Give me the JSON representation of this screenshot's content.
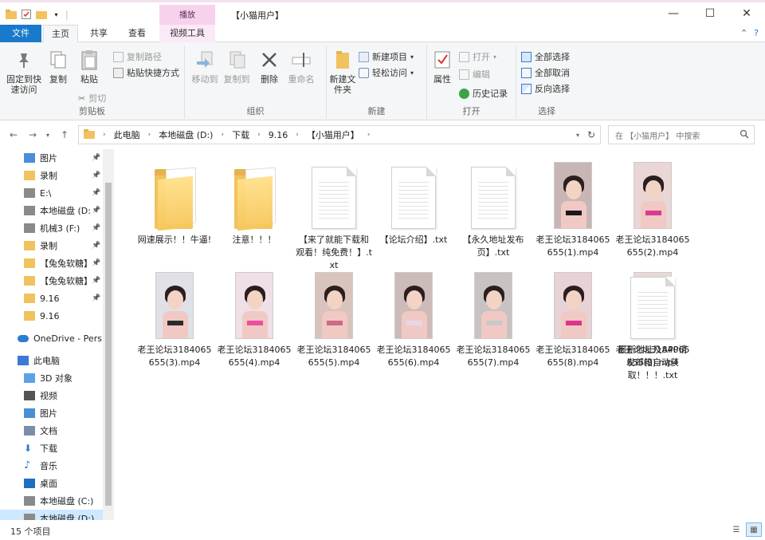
{
  "window": {
    "title": "【小猫用户】",
    "context_tab": "播放",
    "controls": {
      "minimize": "—",
      "maximize": "☐",
      "close": "✕"
    }
  },
  "tabs": [
    {
      "label": "文件"
    },
    {
      "label": "主页"
    },
    {
      "label": "共享"
    },
    {
      "label": "查看"
    },
    {
      "label": "视频工具"
    }
  ],
  "ribbon": {
    "clipboard": {
      "name": "剪贴板",
      "pin": "固定到快速访问",
      "copy": "复制",
      "paste": "粘贴",
      "copy_path": "复制路径",
      "paste_shortcut": "粘贴快捷方式",
      "cut": "剪切"
    },
    "organize": {
      "name": "组织",
      "move_to": "移动到",
      "copy_to": "复制到",
      "delete": "删除",
      "rename": "重命名"
    },
    "new": {
      "name": "新建",
      "new_folder": "新建文件夹",
      "new_item": "新建项目",
      "easy_access": "轻松访问"
    },
    "open": {
      "name": "打开",
      "properties": "属性",
      "open": "打开",
      "edit": "编辑",
      "history": "历史记录"
    },
    "select": {
      "name": "选择",
      "select_all": "全部选择",
      "select_none": "全部取消",
      "invert": "反向选择"
    }
  },
  "address": {
    "crumbs": [
      "此电脑",
      "本地磁盘 (D:)",
      "下载",
      "9.16",
      "【小猫用户】"
    ],
    "search_placeholder": "在 【小猫用户】 中搜索"
  },
  "sidebar": {
    "items": [
      {
        "label": "图片",
        "icon": "pictures-icon",
        "pinned": true
      },
      {
        "label": "录制",
        "icon": "folder-icon",
        "pinned": true
      },
      {
        "label": "E:\\",
        "icon": "drive-icon",
        "pinned": true
      },
      {
        "label": "本地磁盘 (D:",
        "icon": "drive-icon",
        "pinned": true
      },
      {
        "label": "机械3 (F:)",
        "icon": "drive-icon",
        "pinned": true
      },
      {
        "label": "录制",
        "icon": "folder-icon",
        "pinned": true
      },
      {
        "label": "【兔兔软糖】",
        "icon": "folder-icon",
        "pinned": true
      },
      {
        "label": "【兔兔软糖】",
        "icon": "folder-icon",
        "pinned": true
      },
      {
        "label": "9.16",
        "icon": "folder-icon",
        "pinned": true
      },
      {
        "label": "9.16",
        "icon": "folder-icon",
        "pinned": false
      },
      {
        "label": "OneDrive - Pers",
        "icon": "onedrive-icon",
        "pinned": false
      },
      {
        "label": "此电脑",
        "icon": "computer-icon",
        "pinned": false
      },
      {
        "label": "3D 对象",
        "icon": "3d-objects-icon",
        "pinned": false
      },
      {
        "label": "视频",
        "icon": "videos-icon",
        "pinned": false
      },
      {
        "label": "图片",
        "icon": "pictures-icon",
        "pinned": false
      },
      {
        "label": "文档",
        "icon": "documents-icon",
        "pinned": false
      },
      {
        "label": "下载",
        "icon": "downloads-icon",
        "pinned": false
      },
      {
        "label": "音乐",
        "icon": "music-icon",
        "pinned": false
      },
      {
        "label": "桌面",
        "icon": "desktop-icon",
        "pinned": false
      },
      {
        "label": "本地磁盘 (C:)",
        "icon": "drive-icon",
        "pinned": false
      },
      {
        "label": "本地磁盘 (D:)",
        "icon": "drive-icon",
        "pinned": false
      }
    ]
  },
  "files": [
    {
      "name": "网速展示！！牛逼!",
      "type": "folder"
    },
    {
      "name": "注意！！！",
      "type": "folder"
    },
    {
      "name": "【来了就能下载和观看！纯免费！】.txt",
      "type": "txt"
    },
    {
      "name": "【论坛介绍】.txt",
      "type": "txt"
    },
    {
      "name": "【永久地址发布页】.txt",
      "type": "txt"
    },
    {
      "name": "老王论坛3184065655(1).mp4",
      "type": "video",
      "accent": "#1a1a1a",
      "bg": "#c7b6b4"
    },
    {
      "name": "老王论坛3184065655(2).mp4",
      "type": "video",
      "accent": "#d83c8f",
      "bg": "#ead6d4"
    },
    {
      "name": "老王论坛3184065655(3).mp4",
      "type": "video",
      "accent": "#2b2b2b",
      "bg": "#dfe1e6"
    },
    {
      "name": "老王论坛3184065655(4).mp4",
      "type": "video",
      "accent": "#ea4fa0",
      "bg": "#efdfe6"
    },
    {
      "name": "老王论坛3184065655(5).mp4",
      "type": "video",
      "accent": "#cc6b86",
      "bg": "#d9c3bd"
    },
    {
      "name": "老王论坛3184065655(6).mp4",
      "type": "video",
      "accent": "#e4d8e4",
      "bg": "#cdbbb9"
    },
    {
      "name": "老王论坛3184065655(7).mp4",
      "type": "video",
      "accent": "#c9c9c9",
      "bg": "#c9c2c2"
    },
    {
      "name": "老王论坛3184065655(8).mp4",
      "type": "video",
      "accent": "#d8358f",
      "bg": "#e7d2d6"
    },
    {
      "name": "老王论坛3184065655(9).mp4",
      "type": "video",
      "accent": "#e56aa2",
      "bg": "#e8dad8"
    },
    {
      "name": "最新地址及APP请发邮箱自动获取！！！.txt",
      "type": "txt"
    }
  ],
  "status": {
    "count": "15 个项目"
  },
  "colors": {
    "accent": "#1979ca",
    "context": "#f7d2ec",
    "selection": "#cde8ff"
  }
}
